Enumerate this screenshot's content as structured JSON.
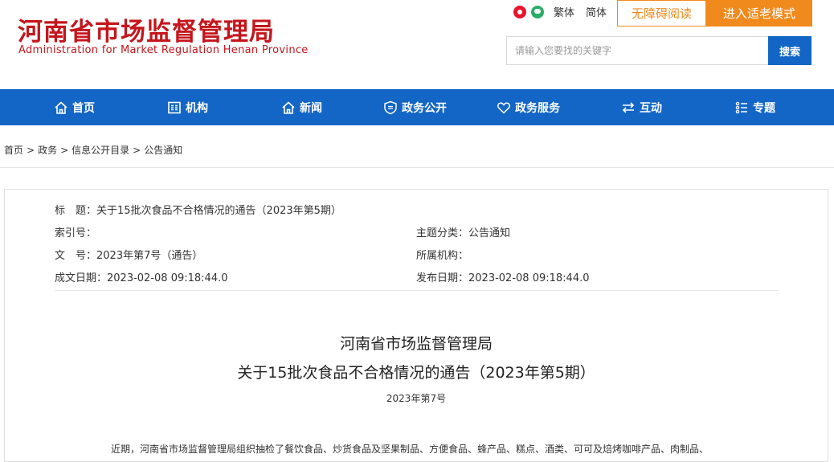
{
  "header": {
    "logo_cn": "河南省市场监督管理局",
    "logo_en": "Administration for Market Regulation Henan Province",
    "lang_trad": "繁体",
    "lang_simp": "简体",
    "accessible_label": "无障碍阅读",
    "elder_mode_label": "进入适老模式",
    "search": {
      "placeholder": "请输入您要找的关键字",
      "button_label": "搜索"
    }
  },
  "nav": {
    "items": [
      {
        "label": "首页",
        "icon": "home-icon"
      },
      {
        "label": "机构",
        "icon": "org-icon"
      },
      {
        "label": "新闻",
        "icon": "news-icon"
      },
      {
        "label": "政务公开",
        "icon": "shield-doc-icon"
      },
      {
        "label": "政务服务",
        "icon": "heart-icon"
      },
      {
        "label": "互动",
        "icon": "exchange-icon"
      },
      {
        "label": "专题",
        "icon": "list-icon"
      }
    ]
  },
  "breadcrumb": [
    "首页",
    "政务",
    "信息公开目录",
    "公告通知"
  ],
  "breadcrumb_sep": ">",
  "meta": {
    "title_label": "标　题：",
    "title_value": "关于15批次食品不合格情况的通告（2023年第5期）",
    "index_label": "索引号：",
    "index_value": "",
    "category_label": "主题分类：",
    "category_value": "公告通知",
    "docno_label": "文　号：",
    "docno_value": "2023年第7号（通告）",
    "org_label": "所属机构：",
    "org_value": "",
    "created_label": "成文日期：",
    "created_value": "2023-02-08 09:18:44.0",
    "published_label": "发布日期：",
    "published_value": "2023-02-08 09:18:44.0"
  },
  "article": {
    "title_line1": "河南省市场监督管理局",
    "title_line2": "关于15批次食品不合格情况的通告（2023年第5期）",
    "doc_number": "2023年第7号",
    "body_start": "近期，河南省市场监督管理局组织抽检了餐饮食品、炒货食品及坚果制品、方便食品、蜂产品、糕点、酒类、可可及焙烤咖啡产品、肉制品、"
  },
  "colors": {
    "brand_red": "#c4161c",
    "nav_blue": "#1366c6",
    "accent_orange": "#f08a1c"
  }
}
